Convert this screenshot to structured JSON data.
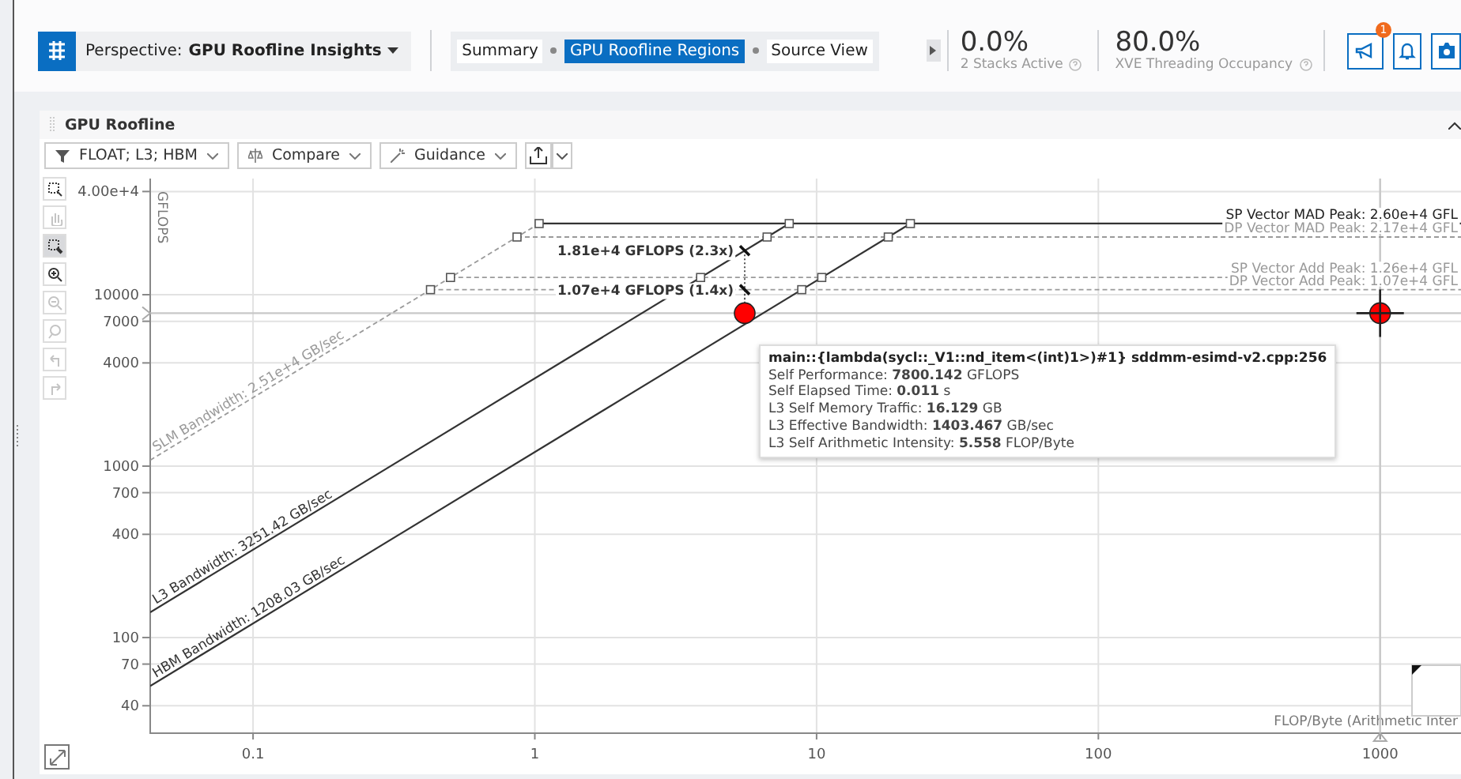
{
  "header": {
    "perspective": {
      "label": "Perspective:",
      "value": "GPU Roofline Insights"
    },
    "views": [
      {
        "label": "Summary",
        "selected": false
      },
      {
        "label": "GPU Roofline Regions",
        "selected": true
      },
      {
        "label": "Source View",
        "selected": false
      }
    ],
    "metrics": [
      {
        "value": "0.0%",
        "label": "2 Stacks Active"
      },
      {
        "value": "80.0%",
        "label": "XVE Threading Occupancy"
      }
    ],
    "notification_count": "1"
  },
  "panel": {
    "title": "GPU Roofline",
    "toolbar": [
      {
        "kind": "filter",
        "label": "FLOAT; L3; HBM"
      },
      {
        "kind": "compare",
        "label": "Compare"
      },
      {
        "kind": "guidance",
        "label": "Guidance"
      }
    ],
    "tools": [
      {
        "kind": "select",
        "selected": false,
        "disabled": false
      },
      {
        "kind": "pan",
        "selected": false,
        "disabled": true
      },
      {
        "kind": "box-select",
        "selected": true,
        "disabled": false
      },
      {
        "kind": "zoom-in",
        "selected": false,
        "disabled": false
      },
      {
        "kind": "zoom-out",
        "selected": false,
        "disabled": true
      },
      {
        "kind": "zoom-reset",
        "selected": false,
        "disabled": true
      },
      {
        "kind": "undo",
        "selected": false,
        "disabled": true
      },
      {
        "kind": "redo",
        "selected": false,
        "disabled": true
      }
    ],
    "roofline": {
      "y_axis_title": "GFLOPS",
      "x_axis_title": "FLOP/Byte (Arithmetic Inter",
      "y_tick_labels": [
        "4.00e+4",
        "10000",
        "7000",
        "4000",
        "1000",
        "700",
        "400",
        "100",
        "70",
        "40"
      ],
      "x_tick_labels": [
        "0.1",
        "1",
        "10",
        "100",
        "1000"
      ],
      "roofs": [
        {
          "kind": "bandwidth",
          "label": "SLM Bandwidth: 2.51e+4 GB/sec",
          "dashed": true
        },
        {
          "kind": "bandwidth",
          "label": "L3 Bandwidth: 3251.42 GB/sec",
          "dashed": false
        },
        {
          "kind": "bandwidth",
          "label": "HBM Bandwidth: 1208.03 GB/sec",
          "dashed": false
        },
        {
          "kind": "peak",
          "label": "SP Vector MAD Peak: 2.60e+4 GFL",
          "dashed": false
        },
        {
          "kind": "peak",
          "label": "DP Vector MAD Peak: 2.17e+4 GFL",
          "dashed": true
        },
        {
          "kind": "peak",
          "label": "SP Vector Add Peak: 1.26e+4 GFL",
          "dashed": true
        },
        {
          "kind": "peak",
          "label": "DP Vector Add Peak: 1.07e+4 GFL",
          "dashed": true
        }
      ],
      "projections": [
        "1.81e+4 GFLOPS (2.3x)",
        "1.07e+4 GFLOPS (1.4x)"
      ]
    },
    "tooltip": {
      "title": "main::{lambda(sycl::_V1::nd_item<(int)1>)#1} sddmm-esimd-v2.cpp:256",
      "lines": [
        "Self Performance: **7800.142** GFLOPS",
        "Self Elapsed Time: **0.011** s",
        "L3 Self Memory Traffic: **16.129** GB",
        "L3 Effective Bandwidth: **1403.467** GB/sec",
        "L3 Self Arithmetic Intensity: **5.558** FLOP/Byte"
      ]
    }
  }
}
